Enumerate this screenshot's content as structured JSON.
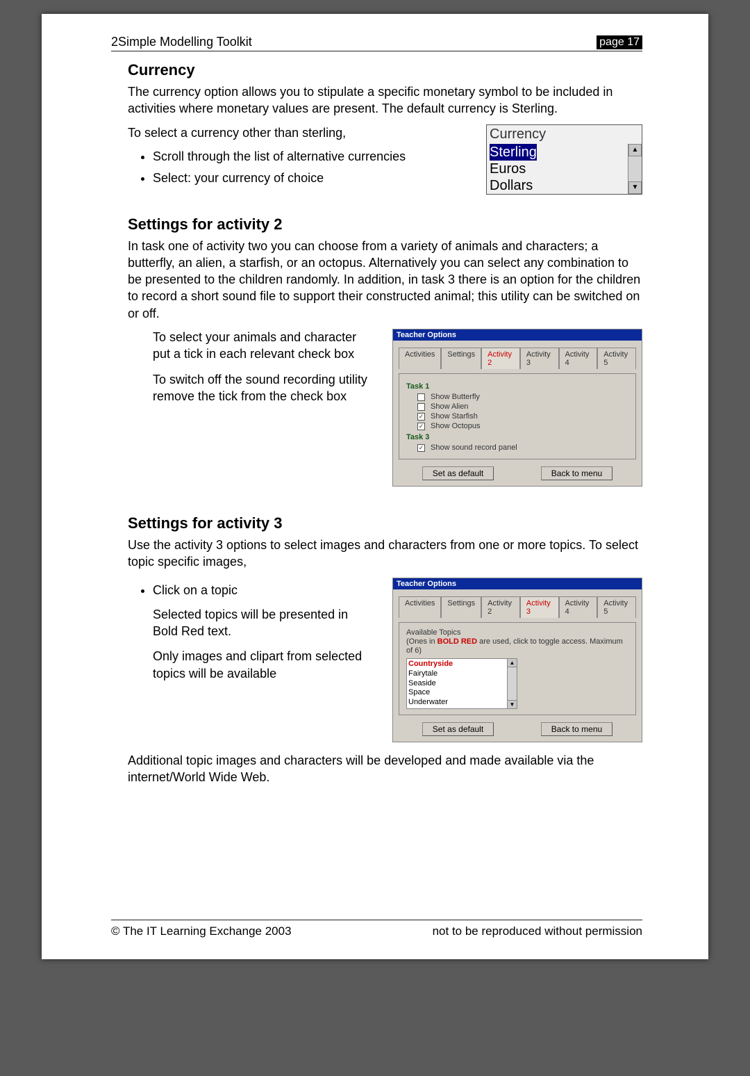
{
  "header": {
    "title": "2Simple Modelling Toolkit",
    "page_tag": "page 17"
  },
  "currency": {
    "heading": "Currency",
    "intro": "The currency option allows you to stipulate a specific monetary symbol to be included in activities where monetary values are present.  The default currency is Sterling.",
    "lead": "To select a currency other than sterling,",
    "b1": "Scroll through the list of alternative currencies",
    "b2": "Select: your currency of choice",
    "widget_title": "Currency",
    "opt_sterling": "Sterling",
    "opt_euros": "Euros",
    "opt_dollars": "Dollars"
  },
  "act2": {
    "heading": "Settings for activity 2",
    "intro": "In task one of activity two you can choose from a variety of animals and characters; a butterfly, an alien, a starfish, or an octopus.  Alternatively you can select any combination to be presented to the children randomly.  In addition, in task 3 there is an option for the children to record a short sound file to support their constructed animal; this utility can be switched on or off.",
    "p1": "To select your animals and character put a tick in each relevant check box",
    "p2": "To switch off the sound recording utility remove the tick from the check box",
    "panel": {
      "title": "Teacher Options",
      "tabs": {
        "t0": "Activities",
        "t1": "Settings",
        "t2": "Activity 2",
        "t3": "Activity 3",
        "t4": "Activity 4",
        "t5": "Activity 5"
      },
      "task1": "Task 1",
      "c1": "Show Butterfly",
      "c2": "Show Alien",
      "c3": "Show Starfish",
      "c4": "Show Octopus",
      "task3": "Task 3",
      "c5": "Show sound record panel",
      "btn_default": "Set as default",
      "btn_back": "Back to menu"
    }
  },
  "act3": {
    "heading": "Settings for activity 3",
    "intro": "Use the activity 3 options to select images and characters from one or more topics.  To select topic specific images,",
    "b1": "Click on a topic",
    "p1": "Selected topics will be presented in Bold Red text.",
    "p2": "Only images and clipart from selected topics will be available",
    "outro": "Additional topic images and characters will be developed and made available via the internet/World Wide Web.",
    "panel": {
      "title": "Teacher Options",
      "tabs": {
        "t0": "Activities",
        "t1": "Settings",
        "t2": "Activity 2",
        "t3": "Activity 3",
        "t4": "Activity 4",
        "t5": "Activity 5"
      },
      "avail": "Available Topics",
      "hint1": "(Ones in ",
      "hint2": "BOLD RED",
      "hint3": " are used, click to toggle access. Maximum of 6)",
      "topics": {
        "t0": "Countryside",
        "t1": "Fairytale",
        "t2": "Seaside",
        "t3": "Space",
        "t4": "Underwater"
      },
      "btn_default": "Set as default",
      "btn_back": "Back to menu"
    }
  },
  "footer": {
    "left": "© The IT Learning Exchange 2003",
    "right": "not to be reproduced without permission"
  }
}
